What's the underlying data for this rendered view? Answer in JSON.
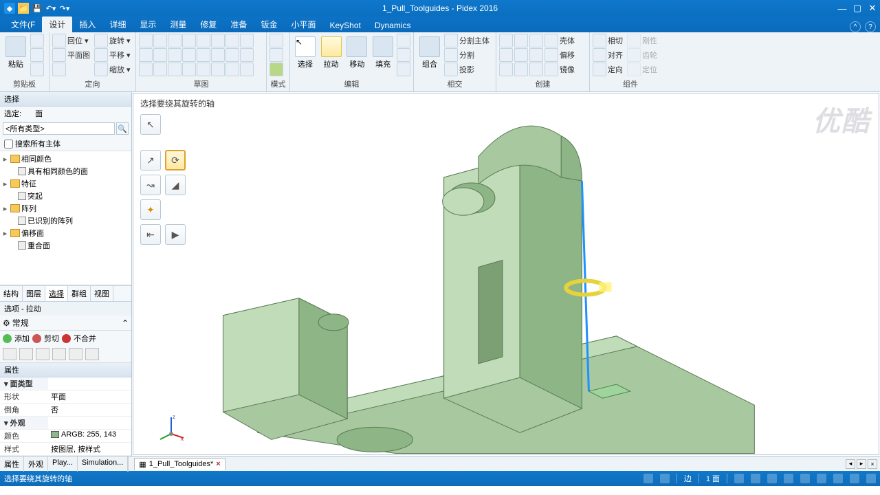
{
  "app": {
    "title": "1_Pull_Toolguides - Pidex 2016"
  },
  "tabs": {
    "items": [
      "文件(F",
      "设计",
      "插入",
      "详细",
      "显示",
      "测量",
      "修复",
      "准备",
      "钣金",
      "小平面",
      "KeyShot",
      "Dynamics"
    ],
    "active_index": 1
  },
  "ribbon": {
    "g_clipboard": {
      "label": "剪贴板",
      "paste": "粘贴"
    },
    "g_orient": {
      "label": "定向",
      "items": [
        "回位 ▾",
        "旋转 ▾",
        "平面图",
        "平移 ▾",
        "",
        "缩放 ▾"
      ]
    },
    "g_sketch": {
      "label": "草图"
    },
    "g_mode": {
      "label": "模式"
    },
    "g_edit": {
      "label": "编辑",
      "select": "选择",
      "pull": "拉动",
      "move": "移动",
      "fill": "填充"
    },
    "g_intersect": {
      "label": "相交",
      "combine": "组合",
      "items": [
        "分割主体",
        "分割",
        "投影"
      ]
    },
    "g_create": {
      "label": "创建",
      "items": [
        "壳体",
        "偏移",
        "镜像"
      ]
    },
    "g_component": {
      "label": "组件",
      "items": [
        "相切",
        "对齐",
        "定向"
      ],
      "dis": [
        "刚性",
        "齿轮",
        "定位"
      ]
    }
  },
  "leftpane": {
    "hdr": "选择",
    "seldef_k": "选定:",
    "seldef_v": "面",
    "filter_ph": "<所有类型>",
    "chk": "搜索所有主体",
    "tree": {
      "n0": "相同颜色",
      "n0a": "具有相同颜色的面",
      "n1": "特征",
      "n1a": "突起",
      "n2": "阵列",
      "n2a": "已识别的阵列",
      "n3": "偏移面",
      "n3a": "重合面"
    },
    "lp_tabs": [
      "结构",
      "图层",
      "选择",
      "群组",
      "视图"
    ],
    "lp_tabs_active": 2,
    "opt_title": "选项 - 拉动",
    "opt_group": "常规",
    "bool": {
      "add": "添加",
      "cut": "剪切",
      "nomerge": "不合并"
    },
    "bottom_tabs": [
      "属性",
      "外观",
      "Play...",
      "Simulation..."
    ],
    "props": {
      "title": "属性",
      "cat1": "面类型",
      "shape_k": "形状",
      "shape_v": "平面",
      "chamf_k": "倒角",
      "chamf_v": "否",
      "cat2": "外观",
      "color_k": "颜色",
      "color_v": "ARGB: 255, 143",
      "style_k": "样式",
      "style_v": "按图层, 按样式"
    }
  },
  "viewport": {
    "hint": "选择要绕其旋转的轴",
    "watermark": "优酷"
  },
  "doctabs": {
    "left": [
      "属性",
      "外观",
      "Play...",
      "Simulation..."
    ],
    "file": "1_Pull_Toolguides*"
  },
  "status": {
    "msg": "选择要绕其旋转的轴",
    "sel_k": "边",
    "sel_v": "1 面"
  },
  "chart_data": null
}
